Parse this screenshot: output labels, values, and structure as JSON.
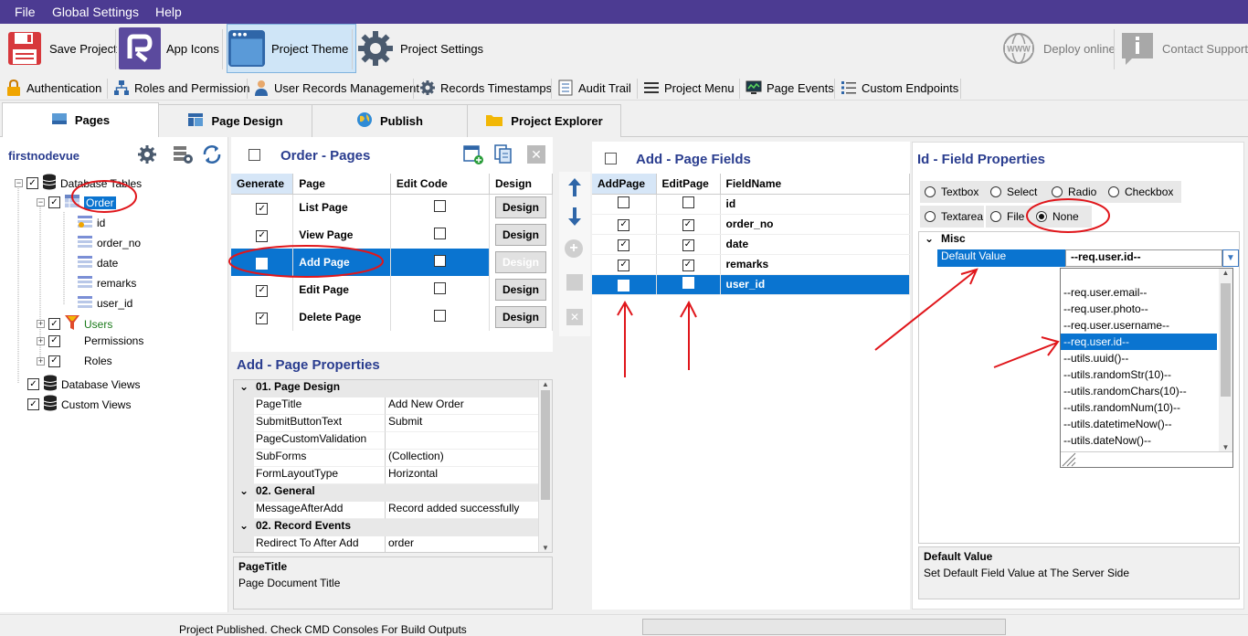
{
  "menu": {
    "file": "File",
    "global_settings": "Global Settings",
    "help": "Help"
  },
  "toolbar": {
    "save_project": "Save Project",
    "app_icons": "App Icons",
    "project_theme": "Project Theme",
    "project_settings": "Project Settings",
    "deploy_online": "Deploy online",
    "contact_support": "Contact Support"
  },
  "toolbar2": {
    "authentication": "Authentication",
    "roles_permission": "Roles and Permission",
    "user_records": "User Records Management",
    "records_timestamps": "Records Timestamps",
    "audit_trail": "Audit Trail",
    "project_menu": "Project Menu",
    "page_events": "Page Events",
    "custom_endpoints": "Custom Endpoints"
  },
  "tabs": {
    "pages": "Pages",
    "page_design": "Page Design",
    "publish": "Publish",
    "project_explorer": "Project Explorer"
  },
  "tree": {
    "project": "firstnodevue",
    "database_tables": "Database Tables",
    "order": "Order",
    "fields": [
      "id",
      "order_no",
      "date",
      "remarks",
      "user_id"
    ],
    "users": "Users",
    "permissions": "Permissions",
    "roles": "Roles",
    "database_views": "Database Views",
    "custom_views": "Custom Views"
  },
  "pages": {
    "title": "Order - Pages",
    "headers": {
      "generate": "Generate",
      "page": "Page",
      "edit_code": "Edit Code",
      "design": "Design"
    },
    "design_btn": "Design",
    "rows": [
      {
        "page": "List Page",
        "generate": true
      },
      {
        "page": "View Page",
        "generate": true
      },
      {
        "page": "Add Page",
        "generate": true
      },
      {
        "page": "Edit Page",
        "generate": true
      },
      {
        "page": "Delete Page",
        "generate": true
      }
    ]
  },
  "page_props": {
    "title": "Add - Page Properties",
    "cat1": "01. Page Design",
    "page_title_k": "PageTitle",
    "page_title_v": "Add New Order",
    "submit_k": "SubmitButtonText",
    "submit_v": "Submit",
    "validation_k": "PageCustomValidation",
    "validation_v": "",
    "subforms_k": "SubForms",
    "subforms_v": "(Collection)",
    "layout_k": "FormLayoutType",
    "layout_v": "Horizontal",
    "cat2": "02. General",
    "message_k": "MessageAfterAdd",
    "message_v": "Record added successfully",
    "cat3": "02. Record Events",
    "redirect_k": "Redirect To After Add",
    "redirect_v": "order",
    "desc_title": "PageTitle",
    "desc_text": "Page Document Title"
  },
  "fields": {
    "title": "Add - Page Fields",
    "headers": {
      "add": "AddPage",
      "edit": "EditPage",
      "name": "FieldName"
    },
    "rows": [
      {
        "name": "id",
        "add": false,
        "edit": false
      },
      {
        "name": "order_no",
        "add": true,
        "edit": true
      },
      {
        "name": "date",
        "add": true,
        "edit": true
      },
      {
        "name": "remarks",
        "add": true,
        "edit": true
      },
      {
        "name": "user_id",
        "add": true,
        "edit": false
      }
    ]
  },
  "field_props": {
    "title": "Id - Field Properties",
    "radios": {
      "textbox": "Textbox",
      "select": "Select",
      "radio": "Radio",
      "checkbox": "Checkbox",
      "textarea": "Textarea",
      "file": "File",
      "none": "None"
    },
    "misc": "Misc",
    "default_value_k": "Default Value",
    "default_value_v": "--req.user.id--",
    "dropdown": [
      "--req.user.email--",
      "--req.user.photo--",
      "--req.user.username--",
      "--req.user.id--",
      "--utils.uuid()--",
      "--utils.randomStr(10)--",
      "--utils.randomChars(10)--",
      "--utils.randomNum(10)--",
      "--utils.datetimeNow()--",
      "--utils.dateNow()--"
    ],
    "desc_title": "Default Value",
    "desc_text": "Set Default Field Value at The Server Side"
  },
  "status": {
    "text": "Project Published. Check CMD Consoles For Build Outputs"
  },
  "colors": {
    "menubar": "#4c3b92",
    "selection": "#0a74d0",
    "heading": "#2a3d8f",
    "annotation": "#e0161b"
  }
}
